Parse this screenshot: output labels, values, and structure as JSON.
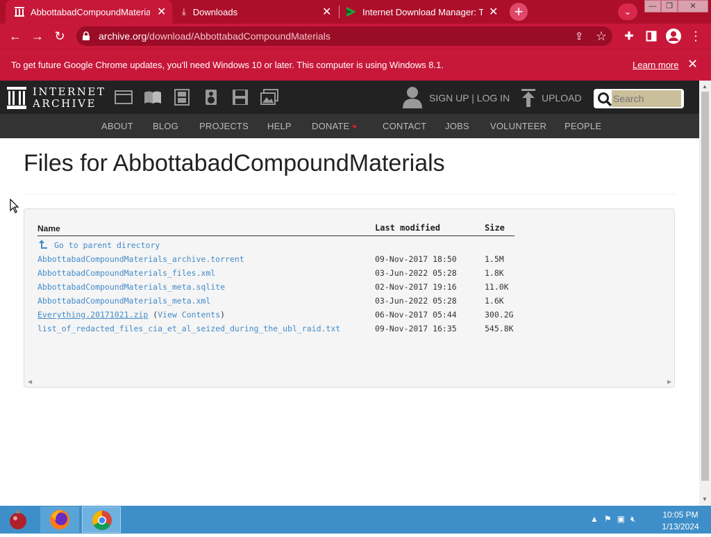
{
  "browser": {
    "tabs": [
      {
        "title": "AbbottabadCompoundMaterials",
        "icon": "archive-favicon",
        "active": true
      },
      {
        "title": "Downloads",
        "icon": "download-icon",
        "active": false
      },
      {
        "title": "Internet Download Manager: The",
        "icon": "idm-icon",
        "active": false
      }
    ],
    "url_host": "archive.org",
    "url_path": "/download/AbbottabadCompoundMaterials",
    "info_bar": {
      "message": "To get future Google Chrome updates, you'll need Windows 10 or later. This computer is using Windows 8.1.",
      "link": "Learn more"
    },
    "accent": "#c8183a"
  },
  "site": {
    "logo_line1": "INTERNET",
    "logo_line2": "ARCHIVE",
    "media_icons": [
      "web-icon",
      "texts-icon",
      "video-icon",
      "audio-icon",
      "software-icon",
      "images-icon"
    ],
    "signup": "SIGN UP | LOG IN",
    "upload": "UPLOAD",
    "search_placeholder": "Search",
    "nav": [
      "ABOUT",
      "BLOG",
      "PROJECTS",
      "HELP",
      "DONATE",
      "CONTACT",
      "JOBS",
      "VOLUNTEER",
      "PEOPLE"
    ]
  },
  "page": {
    "title": "Files for AbbottabadCompoundMaterials",
    "columns": [
      "Name",
      "Last modified",
      "Size"
    ],
    "parent_link": "Go to parent directory",
    "files": [
      {
        "name": "AbbottabadCompoundMaterials_archive.torrent",
        "modified": "09-Nov-2017 18:50",
        "size": "1.5M"
      },
      {
        "name": "AbbottabadCompoundMaterials_files.xml",
        "modified": "03-Jun-2022 05:28",
        "size": "1.8K"
      },
      {
        "name": "AbbottabadCompoundMaterials_meta.sqlite",
        "modified": "02-Nov-2017 19:16",
        "size": "11.0K"
      },
      {
        "name": "AbbottabadCompoundMaterials_meta.xml",
        "modified": "03-Jun-2022 05:28",
        "size": "1.6K"
      },
      {
        "name": "Everything.20171021.zip",
        "extra": "View Contents",
        "modified": "06-Nov-2017 05:44",
        "size": "300.2G"
      },
      {
        "name": "list_of_redacted_files_cia_et_al_seized_during_the_ubl_raid.txt",
        "modified": "09-Nov-2017 16:35",
        "size": "545.8K"
      }
    ]
  },
  "taskbar": {
    "time": "10:05 PM",
    "date": "1/13/2024"
  }
}
